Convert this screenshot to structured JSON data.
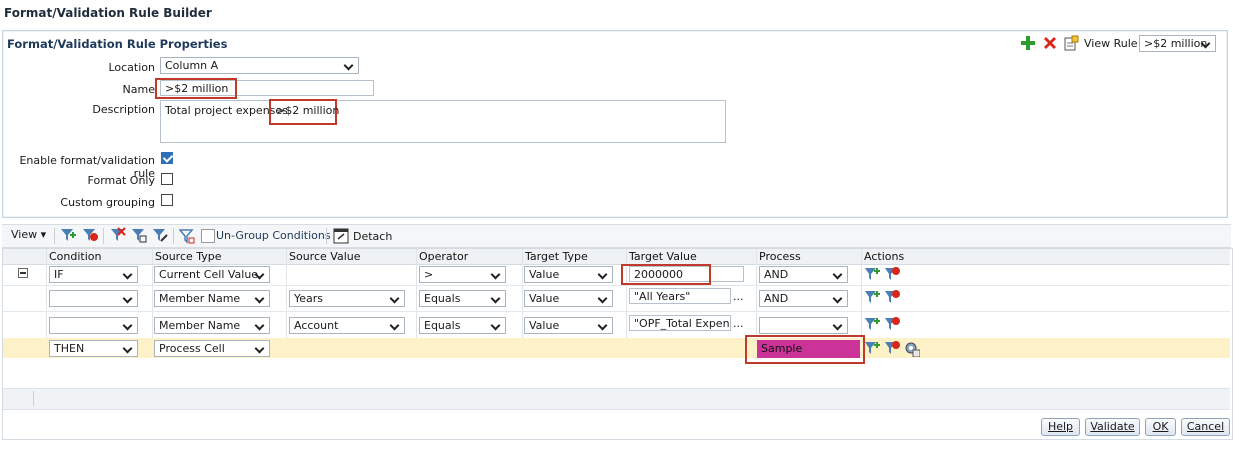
{
  "window": {
    "title": "Format/Validation Rule Builder"
  },
  "properties": {
    "title": "Format/Validation Rule Properties",
    "location_label": "Location",
    "location_value": "Column A",
    "name_label": "Name",
    "name_value": ">$2 million",
    "description_label": "Description",
    "description_value": "Total project expenses",
    "description_highlight": ">$2 million",
    "enable_label": "Enable format/validation rule",
    "enable_checked": true,
    "format_only_label": "Format Only",
    "format_only_checked": false,
    "custom_grouping_label": "Custom grouping",
    "custom_grouping_checked": false,
    "view_rule_label": "View Rule",
    "view_rule_value": ">$2 million"
  },
  "toolbar": {
    "view_label": "View",
    "ungroup_label": "Un-Group Conditions",
    "detach_label": "Detach"
  },
  "grid": {
    "headers": [
      "Condition",
      "Source Type",
      "Source Value",
      "Operator",
      "Target Type",
      "Target Value",
      "Process",
      "Actions"
    ],
    "rows": [
      {
        "condition": "IF",
        "source_type": "Current Cell Value",
        "source_value": "",
        "operator": ">",
        "target_type": "Value",
        "target_value": "2000000",
        "process": "AND"
      },
      {
        "condition": "",
        "source_type": "Member Name",
        "source_value": "Years",
        "operator": "Equals",
        "target_type": "Value",
        "target_value": "\"All Years\"",
        "process": "AND"
      },
      {
        "condition": "",
        "source_type": "Member Name",
        "source_value": "Account",
        "operator": "Equals",
        "target_type": "Value",
        "target_value": "\"OPF_Total Expense",
        "process": ""
      },
      {
        "condition": "THEN",
        "source_type": "Process Cell",
        "process": "Sample"
      }
    ],
    "ellipsis": "..."
  },
  "buttons": {
    "help": "Help",
    "validate": "Validate",
    "ok": "OK",
    "cancel": "Cancel"
  },
  "colors": {
    "sample_fill": "#cc3399",
    "highlight_border": "#c0392b",
    "then_row": "#fdf1c7"
  }
}
